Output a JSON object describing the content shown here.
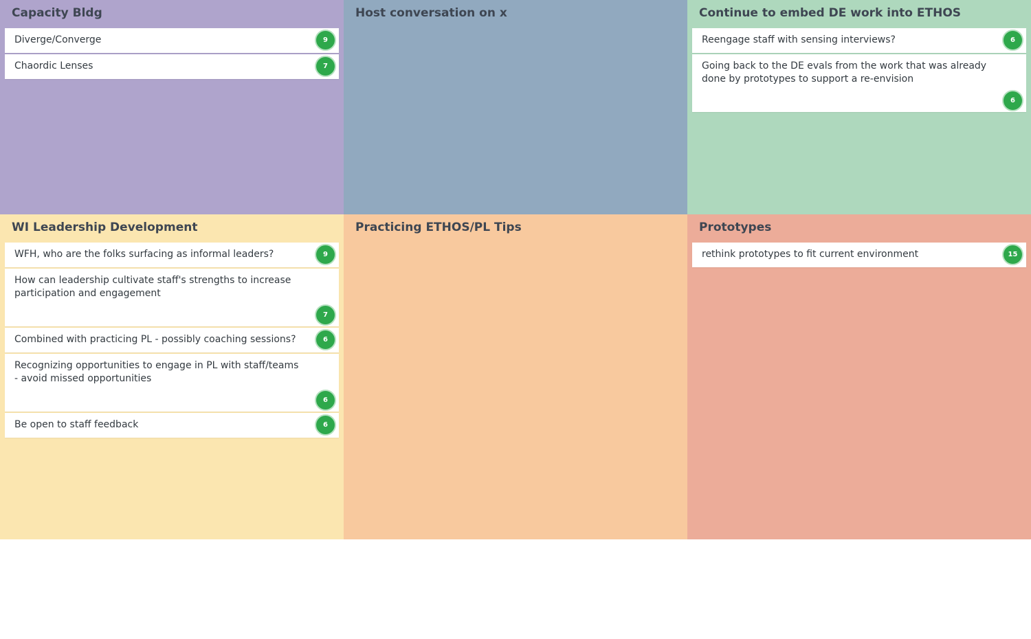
{
  "columns": [
    {
      "title": "Capacity Bldg",
      "color": "#afa4cc",
      "cards": [
        {
          "text": "Diverge/Converge",
          "votes": "9",
          "tall": false
        },
        {
          "text": "Chaordic Lenses",
          "votes": "7",
          "tall": false
        }
      ]
    },
    {
      "title": "Host conversation on x",
      "color": "#91a9bf",
      "cards": []
    },
    {
      "title": "Continue to embed DE work into ETHOS",
      "color": "#aed8bd",
      "cards": [
        {
          "text": "Reengage staff with sensing interviews?",
          "votes": "6",
          "tall": false
        },
        {
          "text": "Going back to the DE evals from the work that was already done by prototypes to support a re-envision",
          "votes": "6",
          "tall": true
        }
      ]
    },
    {
      "title": "WI Leadership Development",
      "color": "#fbe6b0",
      "cards": [
        {
          "text": "WFH, who are the folks surfacing as informal leaders?",
          "votes": "9",
          "tall": false
        },
        {
          "text": "How can leadership cultivate staff's strengths to increase participation and engagement",
          "votes": "7",
          "tall": true
        },
        {
          "text": "Combined with practicing PL - possibly coaching sessions?",
          "votes": "6",
          "tall": false
        },
        {
          "text": "Recognizing opportunities to engage in PL with staff/teams - avoid missed opportunities",
          "votes": "6",
          "tall": true
        },
        {
          "text": "Be open to staff feedback",
          "votes": "6",
          "tall": false
        }
      ]
    },
    {
      "title": "Practicing ETHOS/PL Tips",
      "color": "#f8c99e",
      "cards": []
    },
    {
      "title": "Prototypes",
      "color": "#ecac99",
      "cards": [
        {
          "text": "rethink prototypes to fit current environment",
          "votes": "15",
          "tall": false
        }
      ]
    }
  ]
}
